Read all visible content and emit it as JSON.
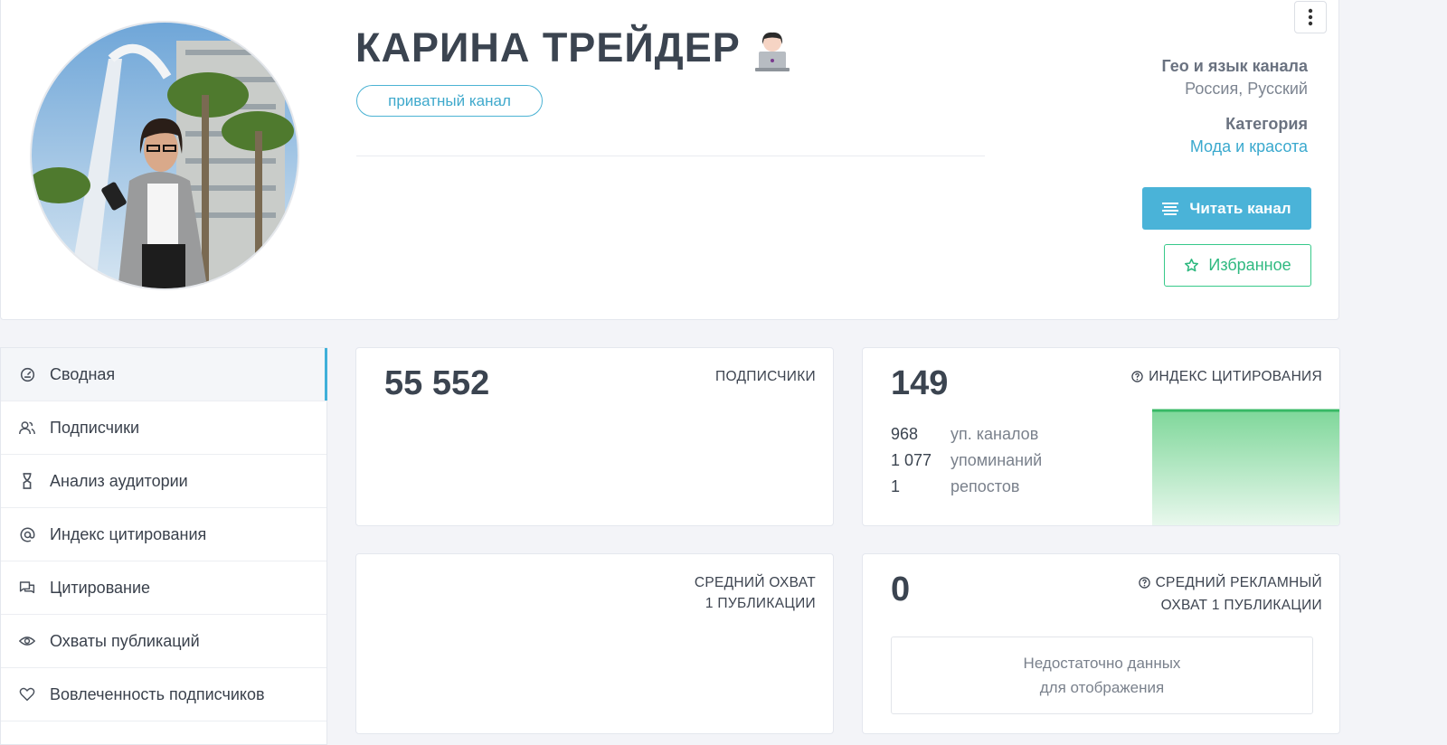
{
  "channel": {
    "title": "КАРИНА ТРЕЙДЕР",
    "private_badge": "приватный канал",
    "geo_label": "Гео и язык канала",
    "geo_value": "Россия, Русский",
    "category_label": "Категория",
    "category_value": "Мода и красота",
    "read_button": "Читать канал",
    "favorite_button": "Избранное"
  },
  "sidebar": {
    "items": [
      {
        "label": "Сводная",
        "icon": "dashboard-icon",
        "active": true
      },
      {
        "label": "Подписчики",
        "icon": "users-icon"
      },
      {
        "label": "Анализ аудитории",
        "icon": "dna-icon"
      },
      {
        "label": "Индекс цитирования",
        "icon": "at-icon"
      },
      {
        "label": "Цитирование",
        "icon": "chat-icon"
      },
      {
        "label": "Охваты публикаций",
        "icon": "eye-icon"
      },
      {
        "label": "Вовлеченность подписчиков",
        "icon": "heart-icon"
      }
    ]
  },
  "stats": {
    "subscribers": {
      "value": "55 552",
      "label": "ПОДПИСЧИКИ"
    },
    "citation": {
      "value": "149",
      "label": "ИНДЕКС ЦИТИРОВАНИЯ",
      "rows": [
        {
          "num": "968",
          "label": "уп. каналов"
        },
        {
          "num": "1 077",
          "label": "упоминаний"
        },
        {
          "num": "1",
          "label": "репостов"
        }
      ]
    },
    "avg_reach": {
      "label_line1": "СРЕДНИЙ ОХВАТ",
      "label_line2": "1 ПУБЛИКАЦИИ"
    },
    "avg_ad_reach": {
      "value": "0",
      "label_line1": "СРЕДНИЙ РЕКЛАМНЫЙ",
      "label_line2": "ОХВАТ 1 ПУБЛИКАЦИИ",
      "no_data_line1": "Недостаточно данных",
      "no_data_line2": "для отображения"
    }
  },
  "colors": {
    "accent": "#4ab3d8",
    "green": "#37c98a"
  }
}
